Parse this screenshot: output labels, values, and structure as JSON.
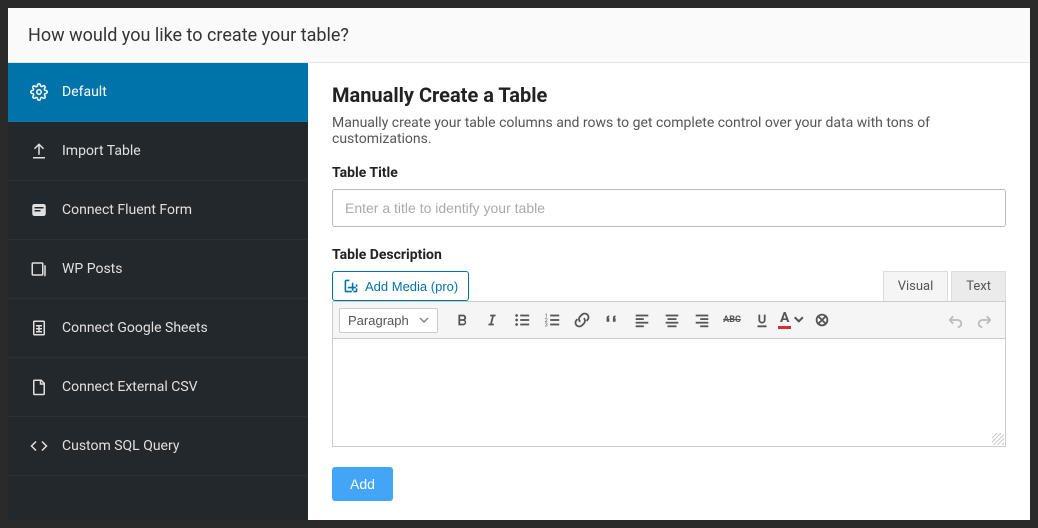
{
  "header": {
    "title": "How would you like to create your table?"
  },
  "sidebar": {
    "items": [
      {
        "label": "Default"
      },
      {
        "label": "Import Table"
      },
      {
        "label": "Connect Fluent Form"
      },
      {
        "label": "WP Posts"
      },
      {
        "label": "Connect Google Sheets"
      },
      {
        "label": "Connect External CSV"
      },
      {
        "label": "Custom SQL Query"
      }
    ]
  },
  "main": {
    "heading": "Manually Create a Table",
    "subtitle": "Manually create your table columns and rows to get complete control over your data with tons of customizations.",
    "title_label": "Table Title",
    "title_placeholder": "Enter a title to identify your table",
    "title_value": "",
    "description_label": "Table Description",
    "add_media_label": "Add Media (pro)",
    "tabs": {
      "visual": "Visual",
      "text": "Text"
    },
    "paragraph_option": "Paragraph",
    "add_button": "Add"
  }
}
